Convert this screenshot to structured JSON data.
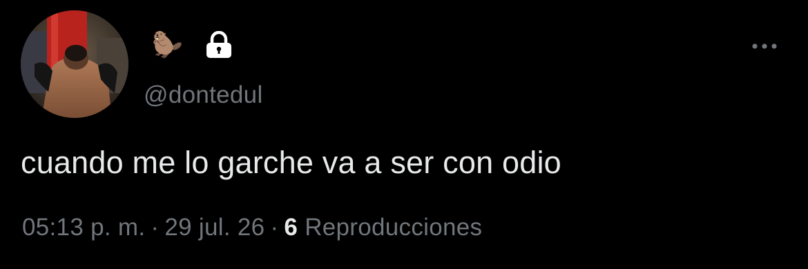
{
  "user": {
    "emoji": "🦫",
    "protected_icon": "lock-icon",
    "handle": "@dontedul"
  },
  "tweet": {
    "text": "cuando me lo garche va a ser con odio"
  },
  "meta": {
    "time": "05:13 p. m.",
    "separator": "·",
    "date": "29 jul. 26",
    "views_count": "6",
    "views_label": "Reproducciones"
  },
  "icons": {
    "more": "more-horizontal-icon"
  },
  "colors": {
    "background": "#000000",
    "text_primary": "#e7e9ea",
    "text_secondary": "#71767b"
  }
}
